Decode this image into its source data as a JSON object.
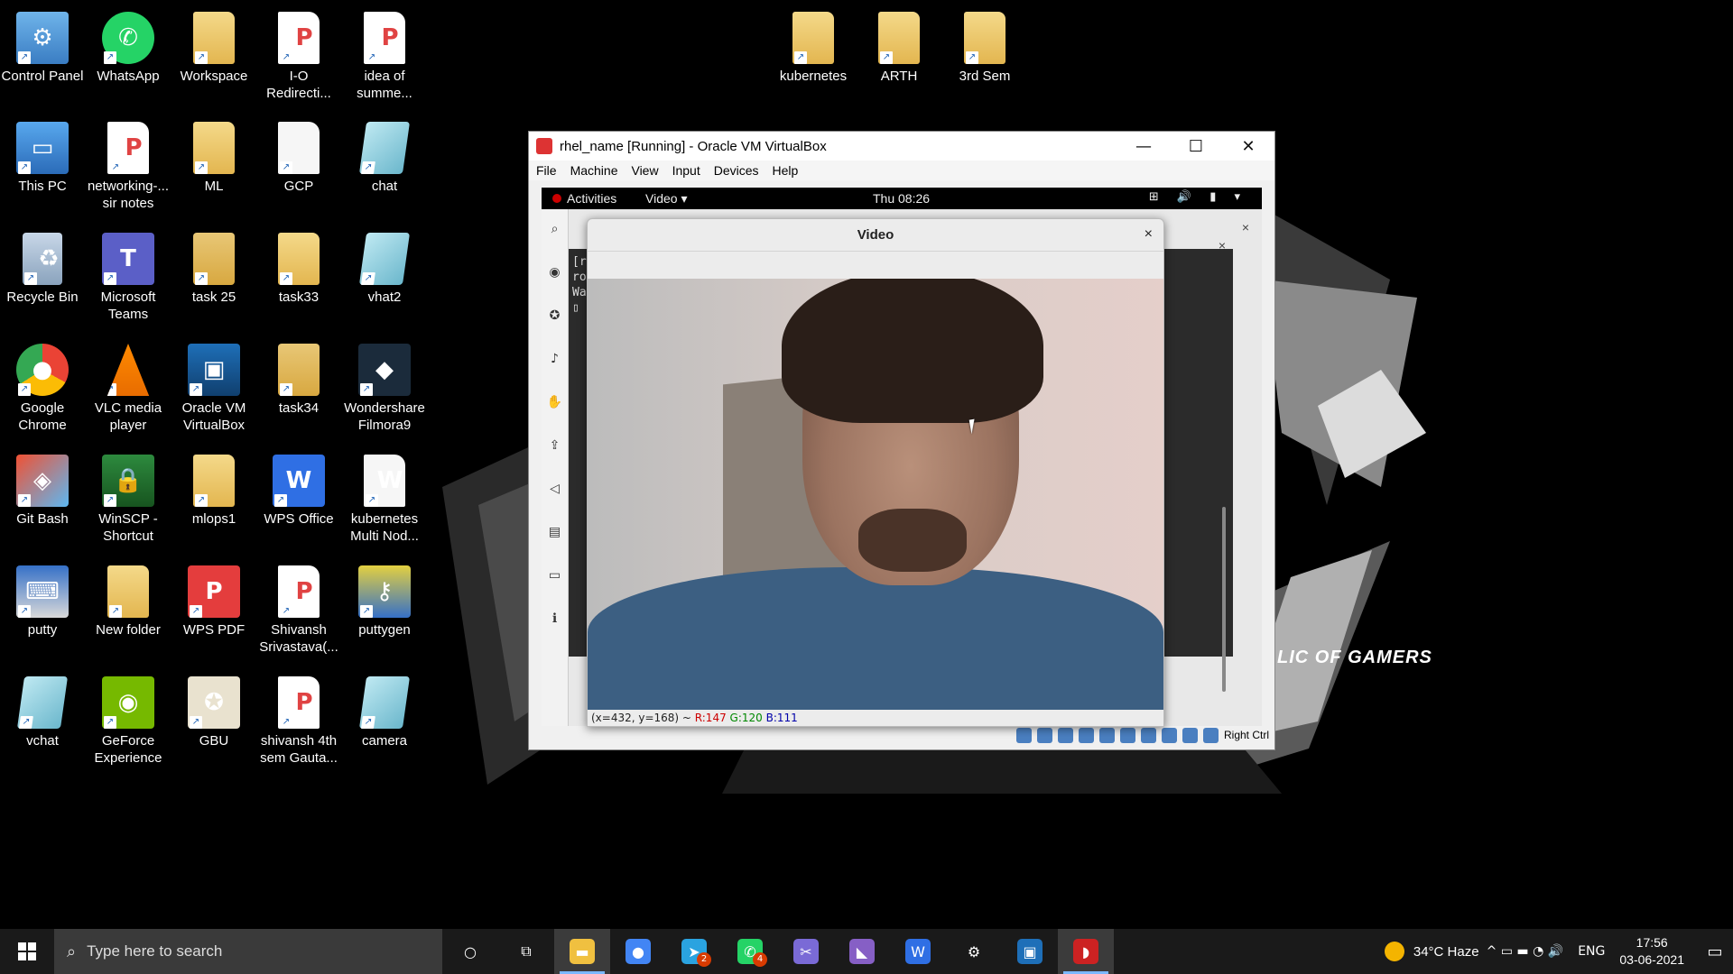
{
  "desktop_icons": [
    {
      "label": "Control Panel",
      "icon": "control-panel-icon",
      "cls": "cp",
      "sym": "⚙"
    },
    {
      "label": "WhatsApp",
      "icon": "whatsapp-icon",
      "cls": "wa",
      "sym": "✆"
    },
    {
      "label": "Workspace",
      "icon": "folder-icon",
      "cls": "folder",
      "sym": ""
    },
    {
      "label": "I-O Redirecti...",
      "icon": "pdf-icon",
      "cls": "pdf",
      "sym": "P"
    },
    {
      "label": "idea of summe...",
      "icon": "presentation-icon",
      "cls": "pdf",
      "sym": "P"
    },
    {
      "label": "This PC",
      "icon": "this-pc-icon",
      "cls": "pc",
      "sym": "▭"
    },
    {
      "label": "networking-... sir notes",
      "icon": "pdf-icon",
      "cls": "pdf",
      "sym": "P"
    },
    {
      "label": "ML",
      "icon": "folder-icon",
      "cls": "folder",
      "sym": ""
    },
    {
      "label": "GCP",
      "icon": "document-icon",
      "cls": "doc",
      "sym": ""
    },
    {
      "label": "chat",
      "icon": "chat-file-icon",
      "cls": "chat",
      "sym": ""
    },
    {
      "label": "Recycle Bin",
      "icon": "recycle-bin-icon",
      "cls": "bin",
      "sym": "♻"
    },
    {
      "label": "Microsoft Teams",
      "icon": "teams-icon",
      "cls": "teams",
      "sym": "T"
    },
    {
      "label": "task 25",
      "icon": "folder-icon",
      "cls": "folder-dark",
      "sym": ""
    },
    {
      "label": "task33",
      "icon": "folder-icon",
      "cls": "folder",
      "sym": ""
    },
    {
      "label": "vhat2",
      "icon": "chat-file-icon",
      "cls": "chat",
      "sym": ""
    },
    {
      "label": "Google Chrome",
      "icon": "chrome-icon",
      "cls": "chrome",
      "sym": "●"
    },
    {
      "label": "VLC media player",
      "icon": "vlc-icon",
      "cls": "vlc",
      "sym": ""
    },
    {
      "label": "Oracle VM VirtualBox",
      "icon": "virtualbox-icon",
      "cls": "vbox",
      "sym": "▣"
    },
    {
      "label": "task34",
      "icon": "folder-icon",
      "cls": "folder-dark",
      "sym": ""
    },
    {
      "label": "Wondershare Filmora9",
      "icon": "filmora-icon",
      "cls": "filmora",
      "sym": "◆"
    },
    {
      "label": "Git Bash",
      "icon": "git-bash-icon",
      "cls": "git",
      "sym": "◈"
    },
    {
      "label": "WinSCP - Shortcut",
      "icon": "winscp-icon",
      "cls": "winscp",
      "sym": "🔒"
    },
    {
      "label": "mlops1",
      "icon": "folder-icon",
      "cls": "folder",
      "sym": ""
    },
    {
      "label": "WPS Office",
      "icon": "wps-office-icon",
      "cls": "wps",
      "sym": "W"
    },
    {
      "label": "kubernetes Multi Nod...",
      "icon": "word-doc-icon",
      "cls": "doc",
      "sym": "W"
    },
    {
      "label": "putty",
      "icon": "putty-icon",
      "cls": "putty",
      "sym": "⌨"
    },
    {
      "label": "New folder",
      "icon": "folder-icon",
      "cls": "folder",
      "sym": ""
    },
    {
      "label": "WPS PDF",
      "icon": "wps-pdf-icon",
      "cls": "wpspdf",
      "sym": "P"
    },
    {
      "label": "Shivansh Srivastava(...",
      "icon": "pdf-icon",
      "cls": "pdf",
      "sym": "P"
    },
    {
      "label": "puttygen",
      "icon": "puttygen-icon",
      "cls": "puttygen",
      "sym": "⚷"
    },
    {
      "label": "vchat",
      "icon": "chat-file-icon",
      "cls": "chat",
      "sym": ""
    },
    {
      "label": "GeForce Experience",
      "icon": "nvidia-icon",
      "cls": "nvidia",
      "sym": "◉"
    },
    {
      "label": "GBU",
      "icon": "certificate-icon",
      "cls": "cert",
      "sym": "✪"
    },
    {
      "label": "shivansh 4th sem Gauta...",
      "icon": "pdf-icon",
      "cls": "pdf",
      "sym": "P"
    },
    {
      "label": "camera",
      "icon": "chat-file-icon",
      "cls": "chat",
      "sym": ""
    },
    {
      "label": "kubernetes",
      "icon": "folder-icon",
      "cls": "folder",
      "sym": ""
    },
    {
      "label": "ARTH",
      "icon": "folder-icon",
      "cls": "folder",
      "sym": ""
    },
    {
      "label": "3rd Sem",
      "icon": "folder-icon",
      "cls": "folder",
      "sym": ""
    }
  ],
  "wallpaper": {
    "text": "LIC OF GAMERS"
  },
  "vbox": {
    "title": "rhel_name [Running] - Oracle VM VirtualBox",
    "menu": [
      "File",
      "Machine",
      "View",
      "Input",
      "Devices",
      "Help"
    ],
    "host_key": "Right Ctrl",
    "window_buttons": {
      "minimize": "—",
      "maximize": "☐",
      "close": "✕"
    }
  },
  "guest": {
    "activities": "Activities",
    "app_menu": "Video ▾",
    "clock": "Thu 08:26",
    "tray": "⊞ 🔊 ▮ ▾",
    "terminal_lines": [
      "[r",
      "ro",
      "Wa",
      "▯"
    ],
    "close_glyph": "×"
  },
  "video_window": {
    "title": "Video",
    "close": "×",
    "status_coords": "(x=432, y=168) ~ ",
    "status_r": "R:147",
    "status_g": "G:120",
    "status_b": "B:111"
  },
  "taskbar": {
    "search_placeholder": "Type here to search",
    "apps": [
      {
        "name": "cortana-button",
        "glyph": "○",
        "color": "transparent"
      },
      {
        "name": "task-view-button",
        "glyph": "⧉",
        "color": "transparent"
      },
      {
        "name": "file-explorer-button",
        "glyph": "▬",
        "color": "#f0c040",
        "active": true
      },
      {
        "name": "chrome-button",
        "glyph": "●",
        "color": "#4285f4"
      },
      {
        "name": "telegram-button",
        "glyph": "➤",
        "color": "#2aa3e0",
        "badge": "2"
      },
      {
        "name": "whatsapp-button",
        "glyph": "✆",
        "color": "#25d366",
        "badge": "4"
      },
      {
        "name": "snip-button",
        "glyph": "✂",
        "color": "#7a6ad6"
      },
      {
        "name": "visual-studio-button",
        "glyph": "◣",
        "color": "#865fc5"
      },
      {
        "name": "wps-button",
        "glyph": "W",
        "color": "#2f6fe4"
      },
      {
        "name": "settings-button",
        "glyph": "⚙",
        "color": "transparent"
      },
      {
        "name": "virtualbox-button",
        "glyph": "▣",
        "color": "#1e6fb8"
      },
      {
        "name": "rhel-vm-button",
        "glyph": "◗",
        "color": "#cc2222",
        "active": true
      }
    ],
    "weather": "34°C  Haze",
    "tray_icons": "^  ▭  ▬  ◔  🔊",
    "language": "ENG",
    "time": "17:56",
    "date": "03-06-2021",
    "notification_glyph": "▭"
  }
}
